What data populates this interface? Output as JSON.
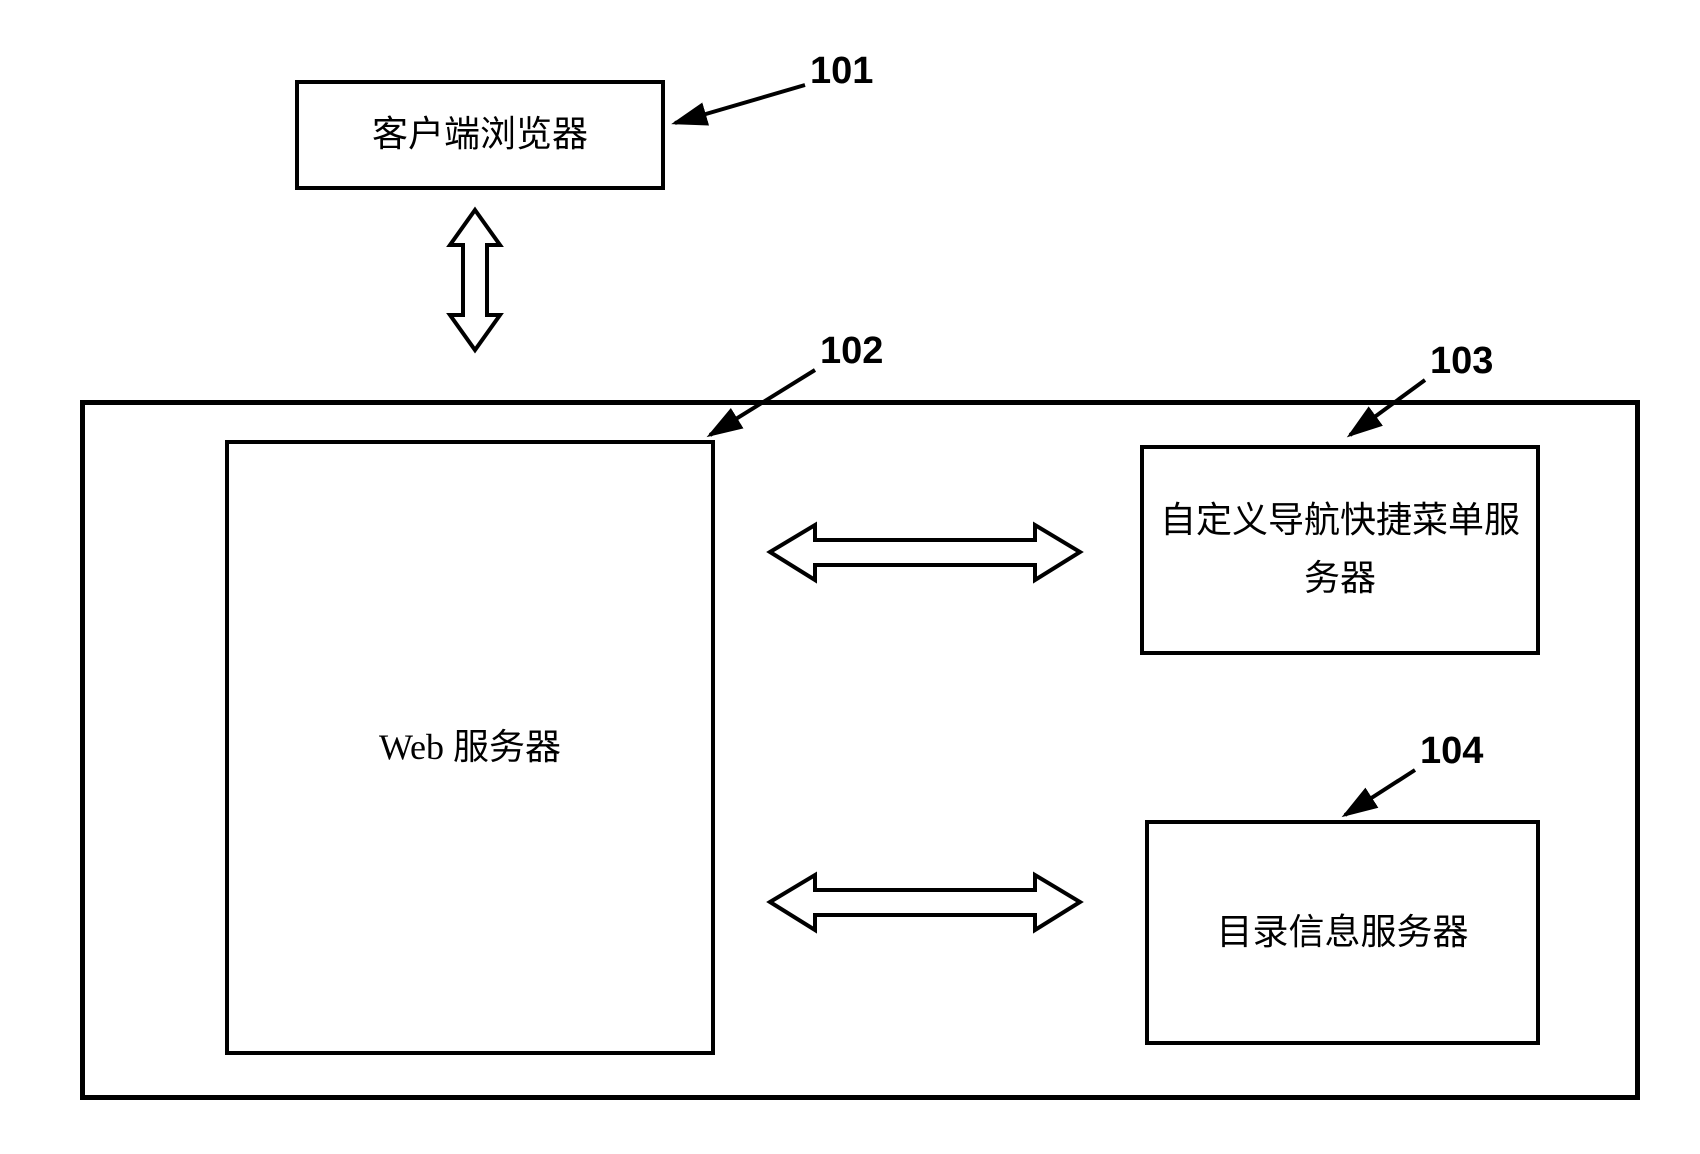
{
  "diagram": {
    "browser_box": "客户端浏览器",
    "web_server_box": "Web 服务器",
    "custom_nav_box": "自定义导航快捷菜单服务器",
    "dir_info_box": "目录信息服务器",
    "label_101": "101",
    "label_102": "102",
    "label_103": "103",
    "label_104": "104"
  }
}
